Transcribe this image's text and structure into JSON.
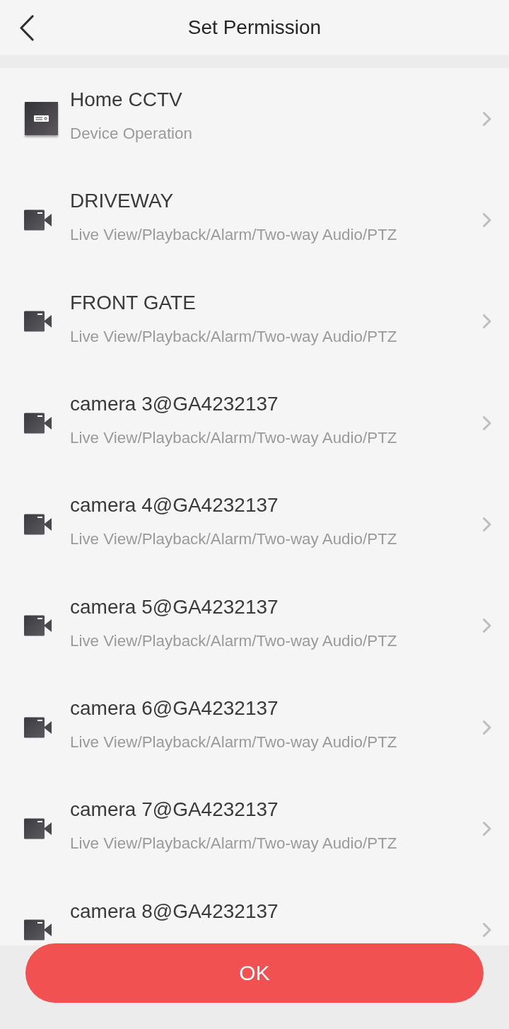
{
  "header": {
    "title": "Set Permission"
  },
  "devices": [
    {
      "kind": "recorder",
      "name": "Home CCTV",
      "permissions": "Device Operation"
    },
    {
      "kind": "camera",
      "name": "DRIVEWAY",
      "permissions": "Live View/Playback/Alarm/Two-way Audio/PTZ"
    },
    {
      "kind": "camera",
      "name": "FRONT GATE",
      "permissions": "Live View/Playback/Alarm/Two-way Audio/PTZ"
    },
    {
      "kind": "camera",
      "name": "camera 3@GA4232137",
      "permissions": "Live View/Playback/Alarm/Two-way Audio/PTZ"
    },
    {
      "kind": "camera",
      "name": "camera 4@GA4232137",
      "permissions": "Live View/Playback/Alarm/Two-way Audio/PTZ"
    },
    {
      "kind": "camera",
      "name": "camera 5@GA4232137",
      "permissions": "Live View/Playback/Alarm/Two-way Audio/PTZ"
    },
    {
      "kind": "camera",
      "name": "camera 6@GA4232137",
      "permissions": "Live View/Playback/Alarm/Two-way Audio/PTZ"
    },
    {
      "kind": "camera",
      "name": "camera 7@GA4232137",
      "permissions": "Live View/Playback/Alarm/Two-way Audio/PTZ"
    },
    {
      "kind": "camera",
      "name": "camera 8@GA4232137"
    }
  ],
  "ok_button": {
    "label": "OK"
  }
}
